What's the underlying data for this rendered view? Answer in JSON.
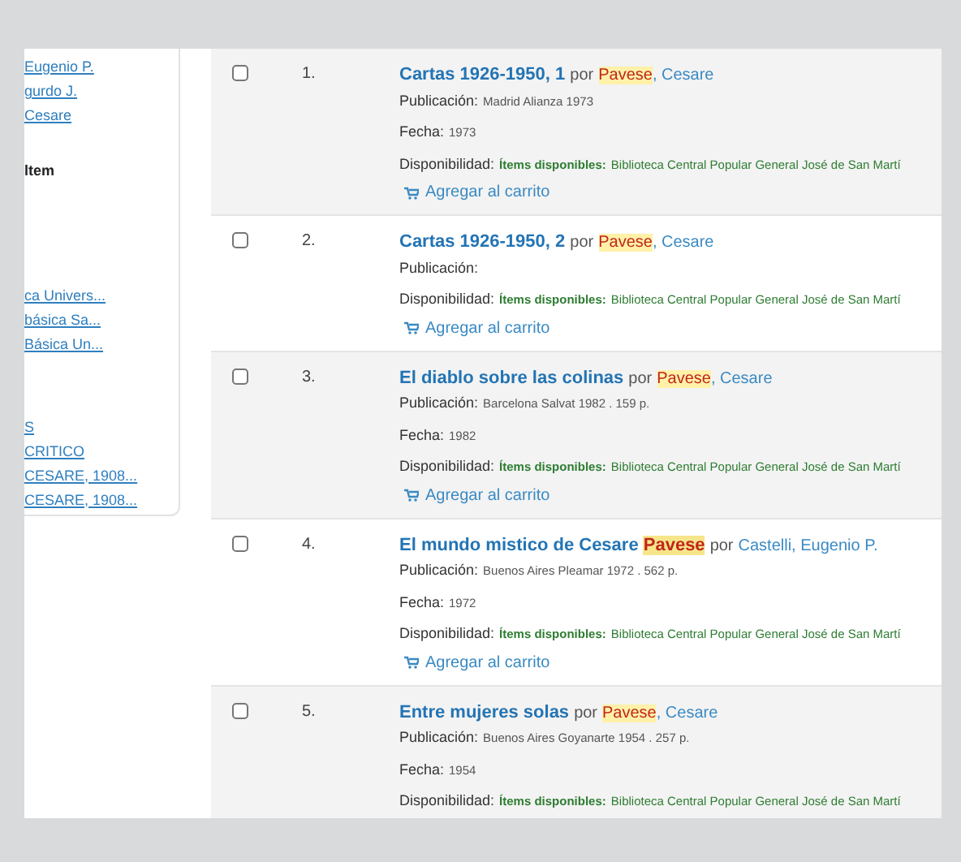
{
  "sidebar": {
    "sections": [
      {
        "kind": "links",
        "items": [
          "Eugenio P.",
          "gurdo J.",
          "Cesare"
        ]
      },
      {
        "kind": "heading",
        "text": "ltem"
      },
      {
        "kind": "links",
        "items": [
          "ca Univers...",
          "básica Sa...",
          "Básica Un..."
        ]
      },
      {
        "kind": "links",
        "items": [
          "S",
          "CRITICO",
          "CESARE, 1908...",
          "CESARE, 1908..."
        ]
      }
    ]
  },
  "results": [
    {
      "number": "1.",
      "title": [
        {
          "text": "Cartas 1926-1950, 1",
          "highlighted": false
        }
      ],
      "by": "por",
      "author": [
        {
          "text": "Pavese",
          "highlighted": true
        },
        {
          "text": ", Cesare",
          "highlighted": false
        }
      ],
      "publication_label": "Publicación:",
      "publication": "Madrid Alianza 1973",
      "date_label": "Fecha:",
      "date": "1973",
      "availability_label": "Disponibilidad:",
      "availability_status": "Ítems disponibles:",
      "availability_library": "Biblioteca Central Popular General José de San Martí",
      "cart": "Agregar al carrito",
      "checked": false
    },
    {
      "number": "2.",
      "title": [
        {
          "text": "Cartas 1926-1950, 2",
          "highlighted": false
        }
      ],
      "by": "por",
      "author": [
        {
          "text": "Pavese",
          "highlighted": true
        },
        {
          "text": ", Cesare",
          "highlighted": false
        }
      ],
      "publication_label": "Publicación:",
      "availability_label": "Disponibilidad:",
      "availability_status": "Ítems disponibles:",
      "availability_library": "Biblioteca Central Popular General José de San Martí",
      "cart": "Agregar al carrito",
      "checked": false
    },
    {
      "number": "3.",
      "title": [
        {
          "text": "El diablo sobre las colinas",
          "highlighted": false
        }
      ],
      "by": "por",
      "author": [
        {
          "text": "Pavese",
          "highlighted": true
        },
        {
          "text": ", Cesare",
          "highlighted": false
        }
      ],
      "publication_label": "Publicación:",
      "publication": "Barcelona Salvat 1982 . 159 p.",
      "date_label": "Fecha:",
      "date": "1982",
      "availability_label": "Disponibilidad:",
      "availability_status": "Ítems disponibles:",
      "availability_library": "Biblioteca Central Popular General José de San Martí",
      "cart": "Agregar al carrito",
      "checked": false
    },
    {
      "number": "4.",
      "title": [
        {
          "text": "El mundo mistico de Cesare ",
          "highlighted": false
        },
        {
          "text": "Pavese",
          "highlighted": true
        }
      ],
      "by": "por",
      "author": [
        {
          "text": "Castelli, Eugenio P.",
          "highlighted": false
        }
      ],
      "publication_label": "Publicación:",
      "publication": "Buenos Aires Pleamar 1972 . 562 p.",
      "date_label": "Fecha:",
      "date": "1972",
      "availability_label": "Disponibilidad:",
      "availability_status": "Ítems disponibles:",
      "availability_library": "Biblioteca Central Popular General José de San Martí",
      "cart": "Agregar al carrito",
      "checked": false
    },
    {
      "number": "5.",
      "title": [
        {
          "text": "Entre mujeres solas",
          "highlighted": false
        }
      ],
      "by": "por",
      "author": [
        {
          "text": "Pavese",
          "highlighted": true
        },
        {
          "text": ", Cesare",
          "highlighted": false
        }
      ],
      "publication_label": "Publicación:",
      "publication": "Buenos Aires Goyanarte 1954 . 257 p.",
      "date_label": "Fecha:",
      "date": "1954",
      "availability_label": "Disponibilidad:",
      "availability_status": "Ítems disponibles:",
      "availability_library": "Biblioteca Central Popular General José de San Martí",
      "checked": false
    }
  ]
}
